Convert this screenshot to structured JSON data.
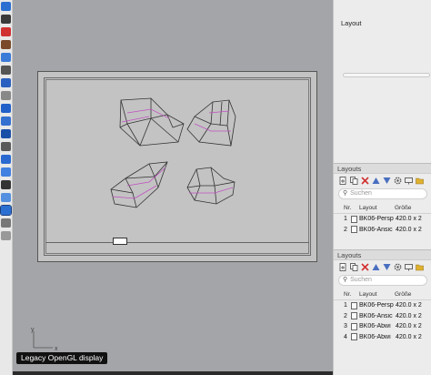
{
  "viewport": {
    "display_badge": "Legacy OpenGL display",
    "axis": {
      "x": "x",
      "y": "y"
    }
  },
  "panel": {
    "title": "Layout",
    "sections": [
      {
        "header": "Layouts",
        "search_placeholder": "Suchen",
        "columns": {
          "nr": "Nr.",
          "layout": "Layout",
          "size": "Größe"
        },
        "rows": [
          {
            "nr": "1",
            "name": "BK06-Persp",
            "size": "420.0 x 2"
          },
          {
            "nr": "2",
            "name": "BK06-Ansic",
            "size": "420.0 x 2"
          }
        ]
      },
      {
        "header": "Layouts",
        "search_placeholder": "Suchen",
        "columns": {
          "nr": "Nr.",
          "layout": "Layout",
          "size": "Größe"
        },
        "rows": [
          {
            "nr": "1",
            "name": "BK06-Persp",
            "size": "420.0 x 2"
          },
          {
            "nr": "2",
            "name": "BK06-Ansic",
            "size": "420.0 x 2"
          },
          {
            "nr": "3",
            "name": "BK06-Abwi",
            "size": "420.0 x 2"
          },
          {
            "nr": "4",
            "name": "BK06-Abwi",
            "size": "420.0 x 2"
          }
        ]
      }
    ]
  },
  "colors": {
    "viewport_bg": "#a3a5a8",
    "paper": "#c3c3c3",
    "geometry": "#333333",
    "highlight": "#c050c0",
    "delete_red": "#d23030",
    "triangle_blue": "#4a6fc0",
    "folder_yellow": "#e0b030"
  }
}
